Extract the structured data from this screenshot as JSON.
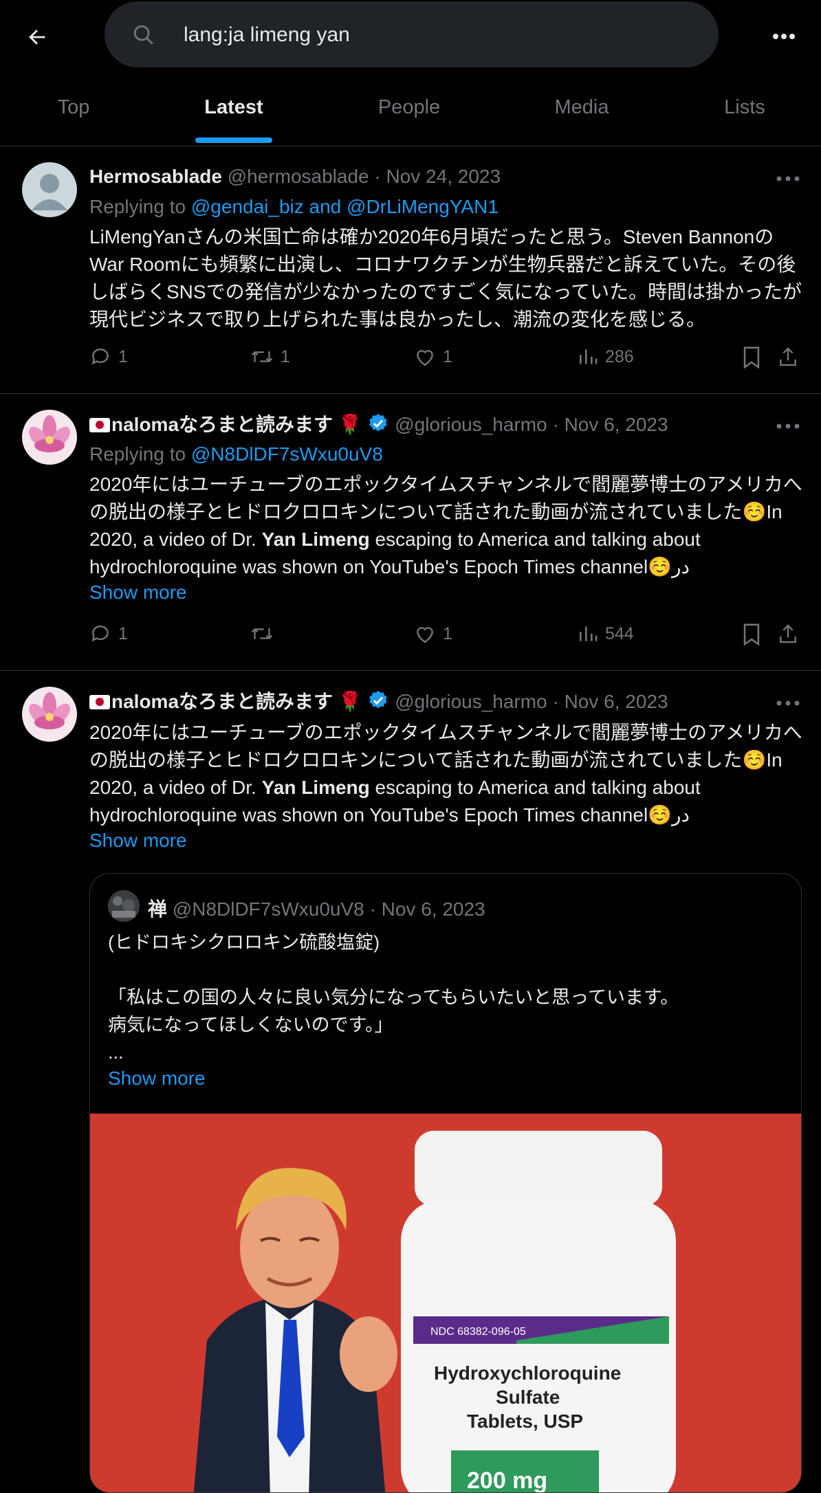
{
  "search": {
    "query": "lang:ja limeng yan"
  },
  "tabs": [
    {
      "label": "Top"
    },
    {
      "label": "Latest"
    },
    {
      "label": "People"
    },
    {
      "label": "Media"
    },
    {
      "label": "Lists"
    }
  ],
  "tweets": [
    {
      "name": "Hermosablade",
      "handle": "@hermosablade",
      "date": "Nov 24, 2023",
      "replying_prefix": "Replying to",
      "replying_to": "@gendai_biz and @DrLiMengYAN1",
      "text": "LiMengYanさんの米国亡命は確か2020年6月頃だったと思う。Steven BannonのWar Roomにも頻繁に出演し、コロナワクチンが生物兵器だと訴えていた。その後しばらくSNSでの発信が少なかったのですごく気になっていた。時間は掛かったが現代ビジネスで取り上げられた事は良かったし、潮流の変化を感じる。",
      "replies": "1",
      "reposts": "1",
      "likes": "1",
      "views": "286"
    },
    {
      "name": "nalomaなろまと読みます",
      "handle": "@glorious_harmo",
      "date": "Nov 6, 2023",
      "replying_prefix": "Replying to",
      "replying_to": "@N8DlDF7sWxu0uV8",
      "text_a": "2020年にはユーチューブのエポックタイムスチャンネルで閻麗夢博士のアメリカへの脱出の様子とヒドロクロロキンについて話された動画が流されていました☺️In 2020, a video of Dr. ",
      "text_bold": "Yan Limeng",
      "text_b": " escaping to America and talking about hydrochloroquine was shown on YouTube's Epoch Times channel☺️در",
      "show_more": "Show more",
      "replies": "1",
      "reposts": "",
      "likes": "1",
      "views": "544"
    },
    {
      "name": "nalomaなろまと読みます",
      "handle": "@glorious_harmo",
      "date": "Nov 6, 2023",
      "text_a": "2020年にはユーチューブのエポックタイムスチャンネルで閻麗夢博士のアメリカへの脱出の様子とヒドロクロロキンについて話された動画が流されていました☺️In 2020, a video of Dr. ",
      "text_bold": "Yan Limeng",
      "text_b": " escaping to America and talking about hydrochloroquine was shown on YouTube's Epoch Times channel☺️در",
      "show_more": "Show more",
      "quote": {
        "name": "禅",
        "handle": "@N8DlDF7sWxu0uV8",
        "date": "Nov 6, 2023",
        "text": "(ヒドロキシクロロキン硫酸塩錠)\n\n「私はこの国の人々に良い気分になってもらいたいと思っています。\n病気になってほしくないのです。」\n...",
        "show_more": "Show more",
        "image": {
          "ndc": "NDC 68382-096-05",
          "line1": "Hydroxychloroquine",
          "line2": "Sulfate",
          "line3": "Tablets, USP",
          "dose": "200 mg"
        }
      }
    }
  ],
  "colors": {
    "accent": "#1d9bf0",
    "muted": "#71767b",
    "text": "#e7e9ea",
    "divider": "#2f3336"
  }
}
